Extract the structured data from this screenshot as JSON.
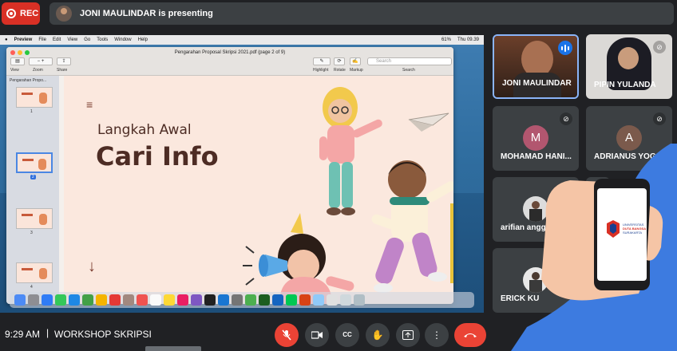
{
  "top": {
    "rec_label": "REC",
    "presenter_text": "JONI MAULINDAR is presenting"
  },
  "shared_screen": {
    "menubar": {
      "app": "Preview",
      "items": [
        "File",
        "Edit",
        "View",
        "Go",
        "Tools",
        "Window",
        "Help"
      ],
      "battery": "61%",
      "clock": "Thu 09.39"
    },
    "preview": {
      "title": "Pengarahan Proposal Skripsi 2021.pdf (page 2 of 9)",
      "toolbar_labels": [
        "View",
        "Zoom",
        "Share"
      ],
      "right_labels": [
        "Highlight",
        "Rotate",
        "Markup"
      ],
      "search_placeholder": "Search",
      "search_label": "Search",
      "sidebar_title": "Pengarahan Propo...",
      "thumb_numbers": [
        "1",
        "2",
        "3",
        "4"
      ],
      "selected_page": "2"
    },
    "slide": {
      "subtitle": "Langkah Awal",
      "title": "Cari Info",
      "menu_glyph": "≡",
      "arrow_glyph": "↓"
    }
  },
  "participants": [
    {
      "name": "JONI MAULINDAR",
      "speaking": true
    },
    {
      "name": "PIPIN YULANDA",
      "muted": true
    },
    {
      "name": "MOHAMAD HANI...",
      "initial": "M",
      "color": "#b2566f",
      "muted": true
    },
    {
      "name": "ADRIANUS YOG...",
      "initial": "A",
      "color": "#7b5a4c",
      "muted": true
    },
    {
      "name": "arifian anggara",
      "muted": true
    },
    {
      "name": "ERICK KU",
      "muted": true
    }
  ],
  "bottom": {
    "time": "9:29 AM",
    "separator": "|",
    "meeting_name": "WORKSHOP SKRIPSI",
    "controls": [
      "mic-off",
      "camera",
      "captions",
      "raise-hand",
      "present",
      "more",
      "leave-call"
    ]
  },
  "overlay": {
    "phone_text": [
      "UNIVERSITAS",
      "DUTA BANGSA",
      "SURAKARTA"
    ]
  },
  "colors": {
    "app_bg": "#202124",
    "tile_bg": "#3c4043",
    "rec": "#d93025",
    "leave": "#ea4335",
    "blue_wave": "#3d7be0"
  }
}
